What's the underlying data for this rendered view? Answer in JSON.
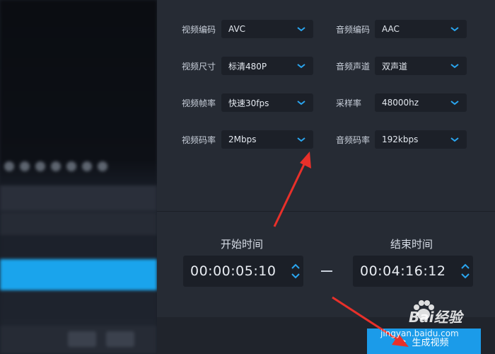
{
  "settings": {
    "video": [
      {
        "label": "视频编码",
        "value": "AVC"
      },
      {
        "label": "视频尺寸",
        "value": "标清480P"
      },
      {
        "label": "视频帧率",
        "value": "快速30fps"
      },
      {
        "label": "视频码率",
        "value": "2Mbps"
      }
    ],
    "audio": [
      {
        "label": "音频编码",
        "value": "AAC"
      },
      {
        "label": "音频声道",
        "value": "双声道"
      },
      {
        "label": "采样率",
        "value": "48000hz"
      },
      {
        "label": "音频码率",
        "value": "192kbps"
      }
    ]
  },
  "time": {
    "start_label": "开始时间",
    "start_value": "00:00:05:10",
    "end_label": "结束时间",
    "end_value": "00:04:16:12",
    "separator": "—"
  },
  "generate_label": "生成视频",
  "watermark": {
    "brand": "Bai经验",
    "url": "jingyan.baidu.com"
  },
  "colors": {
    "accent": "#1b9be9",
    "annotation_arrow": "#e8302a",
    "chevron": "#2aa6f0"
  }
}
